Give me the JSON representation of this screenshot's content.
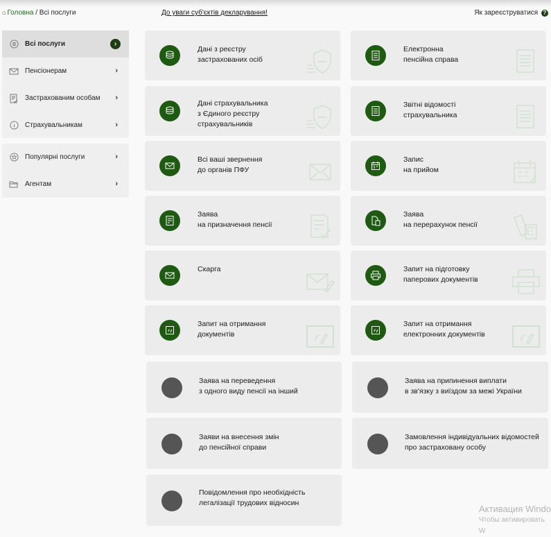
{
  "topbar": {
    "home": "Головна",
    "separator": "/",
    "current": "Всі послуги",
    "notice": "До уваги суб'єктів декларування!",
    "register": "Як зареєструватися",
    "help": "?"
  },
  "sidebar": {
    "group1": [
      {
        "label": "Всі послуги",
        "icon": "list-icon"
      },
      {
        "label": "Пенсіонерам",
        "icon": "envelope-icon"
      },
      {
        "label": "Застрахованим особам",
        "icon": "document-check-icon"
      },
      {
        "label": "Страхувальникам",
        "icon": "info-icon"
      }
    ],
    "group2": [
      {
        "label": "Популярні послуги",
        "icon": "star-icon"
      },
      {
        "label": "Агентам",
        "icon": "folder-icon"
      }
    ],
    "chevron": "›"
  },
  "cards": [
    {
      "lines": [
        "Дані з реєстру",
        "застрахованих осіб"
      ],
      "icon": "shield-database-icon"
    },
    {
      "lines": [
        "Електронна",
        "пенсійна справа"
      ],
      "icon": "folder-document-icon"
    },
    {
      "lines": [
        "Дані страхувальника",
        "з Єдиного реєстру",
        "страхувальників"
      ],
      "icon": "shield-database-icon"
    },
    {
      "lines": [
        "Звітні відомості",
        "страхувальника"
      ],
      "icon": "report-icon"
    },
    {
      "lines": [
        "Всі ваші звернення",
        "до органів ПФУ"
      ],
      "icon": "envelope-icon"
    },
    {
      "lines": [
        "Запис",
        "на прийом"
      ],
      "icon": "calendar-icon"
    },
    {
      "lines": [
        "Заява",
        "на призначення пенсії"
      ],
      "icon": "application-check-icon"
    },
    {
      "lines": [
        "Заява",
        "на перерахунок пенсії"
      ],
      "icon": "calculator-icon"
    },
    {
      "lines": [
        "Скарга"
      ],
      "icon": "complaint-envelope-icon"
    },
    {
      "lines": [
        "Запит на підготовку",
        "паперових документів"
      ],
      "icon": "printer-icon"
    },
    {
      "lines": [
        "Запит на отримання",
        "документів"
      ],
      "icon": "certificate-icon"
    },
    {
      "lines": [
        "Запит на отримання",
        "електронних документів"
      ],
      "icon": "certificate-icon"
    },
    {
      "lines": [
        "Заява на переведення",
        "з одного виду пенсії на інший"
      ],
      "icon": "gray-circle-icon"
    },
    {
      "lines": [
        "Заява на припинення виплати",
        "в зв'язку з виїздом за межі України"
      ],
      "icon": "gray-circle-icon"
    },
    {
      "lines": [
        "Заяви на внесення змін",
        "до пенсійної справи"
      ],
      "icon": "gray-circle-icon"
    },
    {
      "lines": [
        "Замовлення індивідуальних відомостей",
        "про застраховану особу"
      ],
      "icon": "gray-circle-icon"
    },
    {
      "lines": [
        "Повідомлення про необхідність",
        "легалізації трудових відносин"
      ],
      "icon": "gray-circle-icon"
    }
  ],
  "windows_watermark": {
    "line1": "Активация Windo",
    "line2": "Чтобы активировать W"
  },
  "colors": {
    "accent": "#1e5a12",
    "dark_chevron": "#1e3d14",
    "gray_circle": "#555555",
    "card_bg": "#ececec"
  }
}
